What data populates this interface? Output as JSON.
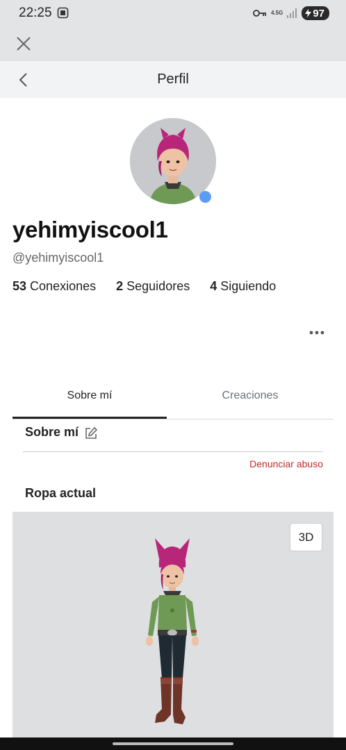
{
  "status_bar": {
    "time": "22:25",
    "network": "4.5G",
    "battery": "97"
  },
  "header": {
    "title": "Perfil"
  },
  "profile": {
    "display_name": "yehimyiscool1",
    "username": "@yehimyiscool1",
    "online": true,
    "stats": [
      {
        "count": "53",
        "label": "Conexiones"
      },
      {
        "count": "2",
        "label": "Seguidores"
      },
      {
        "count": "4",
        "label": "Siguiendo"
      }
    ]
  },
  "tabs": [
    {
      "label": "Sobre mí",
      "active": true
    },
    {
      "label": "Creaciones",
      "active": false
    }
  ],
  "about": {
    "heading": "Sobre mí",
    "report_label": "Denunciar abuso"
  },
  "outfit": {
    "heading": "Ropa actual",
    "view_3d_label": "3D"
  },
  "colors": {
    "online_indicator": "#5b9cf5",
    "report_link": "#c62828",
    "avatar_hair": "#b8267a",
    "avatar_shirt": "#6f9a55"
  }
}
